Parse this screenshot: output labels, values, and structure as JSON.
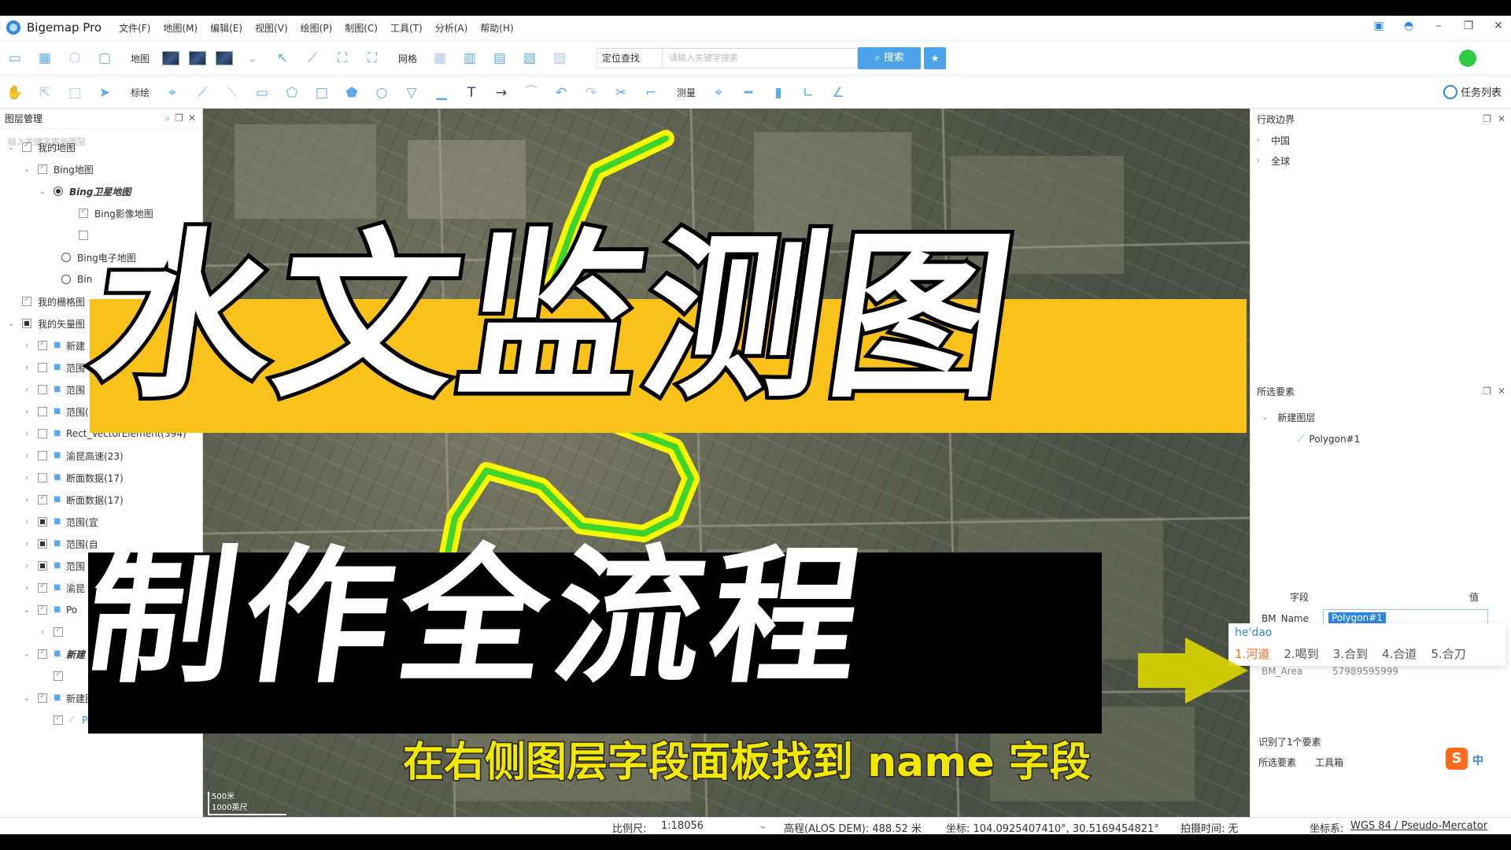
{
  "window": {
    "app_title": "Bigemap Pro",
    "menu": [
      "文件(F)",
      "地图(M)",
      "编辑(E)",
      "视图(V)",
      "绘图(P)",
      "制图(C)",
      "工具(T)",
      "分析(A)",
      "帮助(H)"
    ]
  },
  "toolbar1": {
    "map_label": "地图",
    "grid_label": "网格",
    "locate_select": "定位查找",
    "locate_placeholder": "请输入关键字搜索",
    "search_label": "搜索"
  },
  "toolbar2": {
    "draw_label": "标绘",
    "measure_label": "测量",
    "task_list_label": "任务列表"
  },
  "left_panel": {
    "title": "图层管理",
    "search_placeholder": "输入关键字查询图层",
    "items": [
      {
        "label": "我的地图"
      },
      {
        "label": "Bing地图"
      },
      {
        "label": "Bing卫星地图"
      },
      {
        "label": "Bing影像地图"
      },
      {
        "label": ""
      },
      {
        "label": "Bing电子地图"
      },
      {
        "label": "Bin"
      },
      {
        "label": "我的栅格图"
      },
      {
        "label": "我的矢量图"
      },
      {
        "label": "新建"
      },
      {
        "label": "范围"
      },
      {
        "label": "范围"
      },
      {
        "label": "范围(自贡市)(7)"
      },
      {
        "label": "Rect_VectorElement(394)"
      },
      {
        "label": "渝昆高速(23)"
      },
      {
        "label": "断面数据(17)"
      },
      {
        "label": "断面数据(17)"
      },
      {
        "label": "范围(宜"
      },
      {
        "label": "范围(自"
      },
      {
        "label": "范围"
      },
      {
        "label": "渝昆"
      },
      {
        "label": "Po"
      },
      {
        "label": ""
      },
      {
        "label": "新建"
      },
      {
        "label": ""
      },
      {
        "label": "新建图层(1)"
      },
      {
        "label": "Polygon#1"
      }
    ]
  },
  "right_panel": {
    "admin_title": "行政边界",
    "admin_items": [
      "中国",
      "全球"
    ],
    "selected_title": "所选要素",
    "selected_layer": "新建图层",
    "selected_feature": "Polygon#1",
    "field_header": "字段",
    "value_header": "值",
    "field_name": "BM_Name",
    "field_value": "Polygon#1",
    "ime_pinyin": "he'dao",
    "ime_candidates": [
      "河道",
      "喝到",
      "合到",
      "合道",
      "合刀"
    ],
    "second_field": "BM_Area",
    "second_value": "57989595999",
    "recognized": "识别了1个要素",
    "tabs": [
      "所选要素",
      "工具箱"
    ],
    "sogou_zh": "中"
  },
  "map": {
    "scale_m": "500米",
    "scale_ft": "1000英尺"
  },
  "statusbar": {
    "scale_label": "比例尺:",
    "scale_value": "1:18056",
    "elev": "高程(ALOS DEM): 488.52 米",
    "coord": "坐标: 104.0925407410°, 30.5169454821°",
    "capture_time": "拍摄时间: 无",
    "crs_label": "坐标系:",
    "crs_value": "WGS 84 / Pseudo-Mercator"
  },
  "overlay": {
    "headline": "水文监测图",
    "subline": "制作全流程",
    "caption": "在右侧图层字段面板找到 name 字段"
  },
  "colors": {
    "accent": "#2e86de",
    "banner_yellow": "#f8c21a",
    "caption_yellow": "#f3e900",
    "polygon_outline": "#f6f700",
    "polygon_fill": "#3fd32e"
  }
}
